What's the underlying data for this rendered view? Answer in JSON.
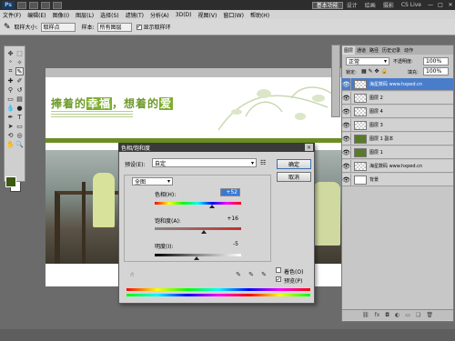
{
  "titlebar": {
    "logo": "Ps",
    "workspaces": [
      "基本功能",
      "设计",
      "绘画",
      "摄影"
    ],
    "cs_live": "CS Live",
    "window_buttons": [
      "—",
      "□",
      "✕"
    ]
  },
  "menu": [
    "文件(F)",
    "编辑(E)",
    "图像(I)",
    "图层(L)",
    "选择(S)",
    "滤镜(T)",
    "分析(A)",
    "3D(D)",
    "视图(V)",
    "窗口(W)",
    "帮助(H)"
  ],
  "options_bar": {
    "size_label": "取样大小:",
    "size_value": "取样点",
    "sample_label": "样本:",
    "sample_value": "所有图层",
    "show_ring_label": "显示取样环"
  },
  "canvas": {
    "headline_pre": "捧着的",
    "headline_hl1": "幸福",
    "headline_mid": "，想着的",
    "headline_hl2": "爱"
  },
  "dialog": {
    "title": "色相/饱和度",
    "preset_label": "预设(E):",
    "preset_value": "自定",
    "channel_value": "全图",
    "hue_label": "色相(H):",
    "hue_value": "+52",
    "saturation_label": "饱和度(A):",
    "saturation_value": "+16",
    "lightness_label": "明度(I):",
    "lightness_value": "-5",
    "ok_label": "确定",
    "cancel_label": "取消",
    "colorize_label": "着色(O)",
    "preview_label": "预览(P)",
    "colorize_checked": false,
    "preview_checked": true
  },
  "layers_panel": {
    "tabs": [
      "图层",
      "通道",
      "路径",
      "历史记录",
      "动作"
    ],
    "blend_mode": "正常",
    "opacity_label": "不透明度:",
    "opacity_value": "100%",
    "lock_label": "锁定:",
    "fill_label": "填充:",
    "fill_value": "100%",
    "layers": [
      {
        "name": "海星数码 www.hxped.cn",
        "selected": true,
        "thumb": "text"
      },
      {
        "name": "图层 2",
        "selected": false,
        "thumb": "checker"
      },
      {
        "name": "图层 4",
        "selected": false,
        "thumb": "checker"
      },
      {
        "name": "图层 3",
        "selected": false,
        "thumb": "checker"
      },
      {
        "name": "图层 1 副本",
        "selected": false,
        "thumb": "grn"
      },
      {
        "name": "图层 1",
        "selected": false,
        "thumb": "grn"
      },
      {
        "name": "海星数码 www.hxped.cn",
        "selected": false,
        "thumb": "text"
      },
      {
        "name": "背景",
        "selected": false,
        "thumb": "white"
      }
    ]
  },
  "colors": {
    "foreground": "#3d5a12",
    "background": "#ffffff"
  }
}
